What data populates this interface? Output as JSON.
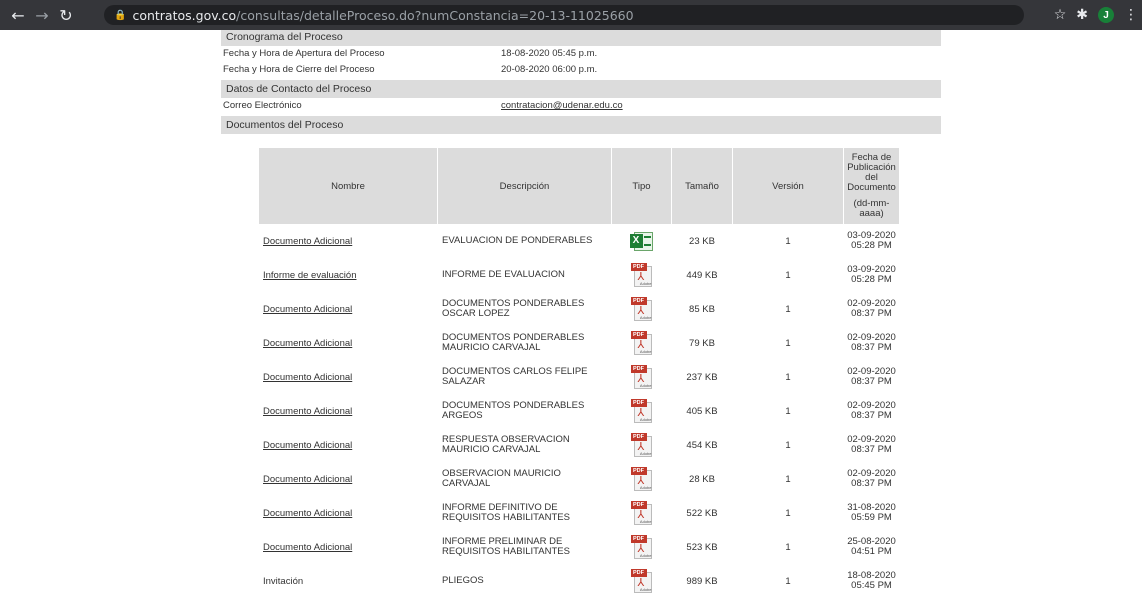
{
  "browser": {
    "url_host": "contratos.gov.co",
    "url_path": "/consultas/detalleProceso.do?numConstancia=20-13-11025660",
    "profile_initial": "J"
  },
  "sections": {
    "cronograma": "Cronograma del Proceso",
    "contacto": "Datos de Contacto del Proceso",
    "documentos": "Documentos del Proceso"
  },
  "cronograma_fields": [
    {
      "label": "Fecha y Hora de Apertura del Proceso",
      "value": "18-08-2020 05:45 p.m."
    },
    {
      "label": "Fecha y Hora de Cierre del Proceso",
      "value": "20-08-2020 06:00 p.m."
    }
  ],
  "contacto_fields": [
    {
      "label": "Correo Electrónico",
      "value": "contratacion@udenar.edu.co"
    }
  ],
  "table": {
    "headers": {
      "nombre": "Nombre",
      "descripcion": "Descripción",
      "tipo": "Tipo",
      "tamano": "Tamaño",
      "version": "Versión",
      "fecha_l1": "Fecha de",
      "fecha_l2": "Publicación",
      "fecha_l3": "del",
      "fecha_l4": "Documento",
      "fecha_l5": "(dd-mm-",
      "fecha_l6": "aaaa)"
    },
    "rows": [
      {
        "nombre": "Documento Adicional",
        "desc1": "EVALUACION DE PONDERABLES",
        "desc2": "",
        "tipo": "xls-icon",
        "tamano": "23 KB",
        "version": "1",
        "fecha": "03-09-2020",
        "hora": "05:28 PM"
      },
      {
        "nombre": "Informe de evaluación",
        "desc1": "INFORME DE EVALUACION",
        "desc2": "",
        "tipo": "pdf-icon",
        "tamano": "449 KB",
        "version": "1",
        "fecha": "03-09-2020",
        "hora": "05:28 PM"
      },
      {
        "nombre": "Documento Adicional",
        "desc1": "DOCUMENTOS PONDERABLES",
        "desc2": "OSCAR LOPEZ",
        "tipo": "pdf-icon",
        "tamano": "85 KB",
        "version": "1",
        "fecha": "02-09-2020",
        "hora": "08:37 PM"
      },
      {
        "nombre": "Documento Adicional",
        "desc1": "DOCUMENTOS PONDERABLES",
        "desc2": "MAURICIO CARVAJAL",
        "tipo": "pdf-icon",
        "tamano": "79 KB",
        "version": "1",
        "fecha": "02-09-2020",
        "hora": "08:37 PM"
      },
      {
        "nombre": "Documento Adicional",
        "desc1": "DOCUMENTOS CARLOS FELIPE",
        "desc2": "SALAZAR",
        "tipo": "pdf-icon",
        "tamano": "237 KB",
        "version": "1",
        "fecha": "02-09-2020",
        "hora": "08:37 PM"
      },
      {
        "nombre": "Documento Adicional",
        "desc1": "DOCUMENTOS PONDERABLES",
        "desc2": "ARGEOS",
        "tipo": "pdf-icon",
        "tamano": "405 KB",
        "version": "1",
        "fecha": "02-09-2020",
        "hora": "08:37 PM"
      },
      {
        "nombre": "Documento Adicional",
        "desc1": "RESPUESTA OBSERVACION",
        "desc2": "MAURICIO CARVAJAL",
        "tipo": "pdf-icon",
        "tamano": "454 KB",
        "version": "1",
        "fecha": "02-09-2020",
        "hora": "08:37 PM"
      },
      {
        "nombre": "Documento Adicional",
        "desc1": "OBSERVACION MAURICIO CARVAJAL",
        "desc2": "",
        "tipo": "pdf-icon",
        "tamano": "28 KB",
        "version": "1",
        "fecha": "02-09-2020",
        "hora": "08:37 PM"
      },
      {
        "nombre": "Documento Adicional",
        "desc1": "INFORME DEFINITIVO DE",
        "desc2": "REQUISITOS HABILITANTES",
        "tipo": "pdf-icon",
        "tamano": "522 KB",
        "version": "1",
        "fecha": "31-08-2020",
        "hora": "05:59 PM"
      },
      {
        "nombre": "Documento Adicional",
        "desc1": "INFORME PRELIMINAR DE",
        "desc2": "REQUISITOS HABILITANTES",
        "tipo": "pdf-icon",
        "tamano": "523 KB",
        "version": "1",
        "fecha": "25-08-2020",
        "hora": "04:51 PM"
      },
      {
        "nombre": "Invitación",
        "desc1": "PLIEGOS",
        "desc2": "",
        "tipo": "pdf-icon",
        "tamano": "989 KB",
        "version": "1",
        "fecha": "18-08-2020",
        "hora": "05:45 PM"
      }
    ]
  }
}
